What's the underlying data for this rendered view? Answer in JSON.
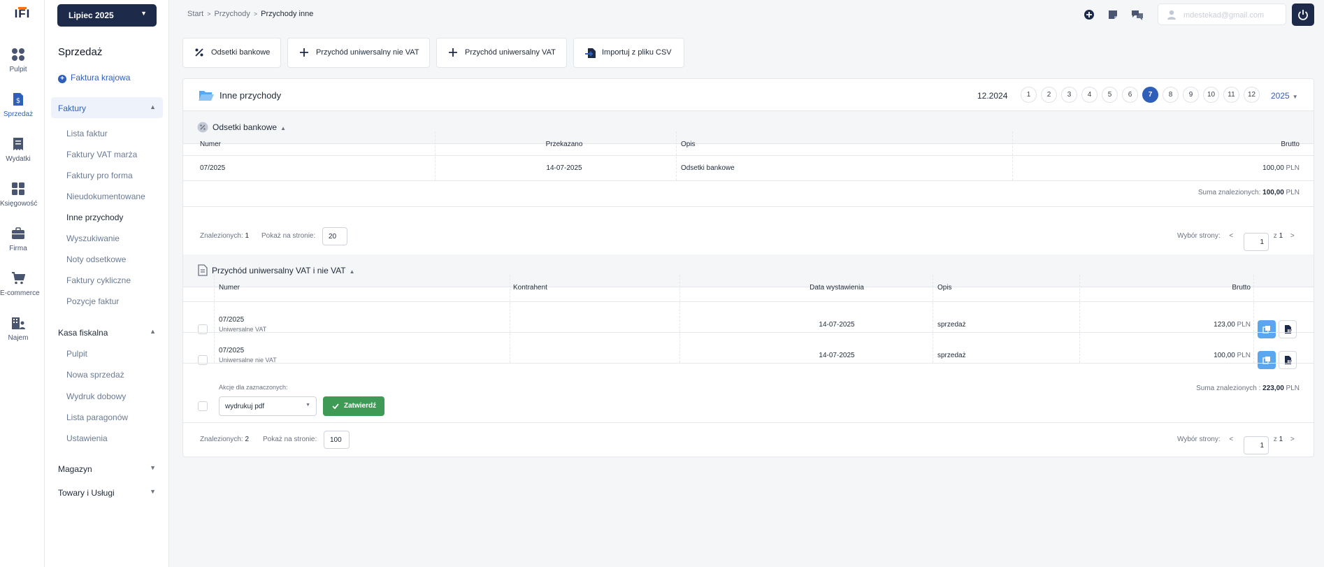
{
  "logo": "IFI",
  "rail": [
    {
      "label": "Pulpit",
      "icon": "grid-icon"
    },
    {
      "label": "Sprzedaż",
      "icon": "invoice-dollar-icon"
    },
    {
      "label": "Wydatki",
      "icon": "receipt-icon"
    },
    {
      "label": "Księgowość",
      "icon": "calculator-icon"
    },
    {
      "label": "Firma",
      "icon": "briefcase-icon"
    },
    {
      "label": "E-commerce",
      "icon": "cart-icon"
    },
    {
      "label": "Najem",
      "icon": "building-icon"
    }
  ],
  "sidebar": {
    "month": "Lipiec 2025",
    "title": "Sprzedaż",
    "new_invoice": "Faktura krajowa",
    "group_faktury": "Faktury",
    "faktury_items": [
      "Lista faktur",
      "Faktury VAT marża",
      "Faktury pro forma",
      "Nieudokumentowane",
      "Inne przychody",
      "Wyszukiwanie",
      "Noty odsetkowe",
      "Faktury cykliczne",
      "Pozycje faktur"
    ],
    "group_kasa": "Kasa fiskalna",
    "kasa_items": [
      "Pulpit",
      "Nowa sprzedaż",
      "Wydruk dobowy",
      "Lista paragonów",
      "Ustawienia"
    ],
    "group_magazyn": "Magazyn",
    "group_towary": "Towary i Usługi"
  },
  "breadcrumb": [
    "Start",
    "Przychody",
    "Przychody inne"
  ],
  "user_email": "mdestekad@gmail.com",
  "actions": [
    "Odsetki bankowe",
    "Przychód uniwersalny nie VAT",
    "Przychód uniwersalny VAT",
    "Importuj z pliku CSV"
  ],
  "panel": {
    "title": "Inne przychody",
    "period": "12.2024",
    "months": [
      "1",
      "2",
      "3",
      "4",
      "5",
      "6",
      "7",
      "8",
      "9",
      "10",
      "11",
      "12"
    ],
    "selected_month": "7",
    "year": "2025"
  },
  "section1": {
    "title": "Odsetki bankowe",
    "columns": [
      "Numer",
      "Przekazano",
      "Opis",
      "Brutto"
    ],
    "rows": [
      {
        "numer": "07/2025",
        "przekazano": "14-07-2025",
        "opis": "Odsetki bankowe",
        "brutto": "100,00",
        "waluta": "PLN"
      }
    ],
    "sum_label": "Suma znalezionych:",
    "sum_value": "100,00",
    "currency": "PLN",
    "found_label": "Znalezionych:",
    "found": "1",
    "per_page_label": "Pokaż na stronie:",
    "per_page": "20",
    "page_label": "Wybór strony:",
    "page": "1",
    "of_label": "z",
    "pages": "1"
  },
  "section2": {
    "title": "Przychód uniwersalny VAT i nie VAT",
    "columns": [
      "Numer",
      "Kontrahent",
      "Data wystawienia",
      "Opis",
      "Brutto"
    ],
    "rows": [
      {
        "numer": "07/2025",
        "typ": "Uniwersalne VAT",
        "kontrahent": "",
        "data": "14-07-2025",
        "opis": "sprzedaż",
        "brutto": "123,00",
        "waluta": "PLN"
      },
      {
        "numer": "07/2025",
        "typ": "Uniwersalne nie VAT",
        "kontrahent": "",
        "data": "14-07-2025",
        "opis": "sprzedaż",
        "brutto": "100,00",
        "waluta": "PLN"
      }
    ],
    "bulk_label": "Akcje dla zaznaczonych:",
    "bulk_select": "wydrukuj pdf",
    "confirm": "Zatwierdź",
    "sum_label": "Suma znalezionych :",
    "sum_value": "223,00",
    "currency": "PLN",
    "found_label": "Znalezionych:",
    "found": "2",
    "per_page_label": "Pokaż na stronie:",
    "per_page": "100",
    "page_label": "Wybór strony:",
    "page": "1",
    "of_label": "z",
    "pages": "1"
  },
  "colors": {
    "navy": "#1e2a4a",
    "accent": "#2f5fb8",
    "green": "#3f9a55",
    "orange": "#f97316",
    "light_blue": "#5aa6ef"
  }
}
